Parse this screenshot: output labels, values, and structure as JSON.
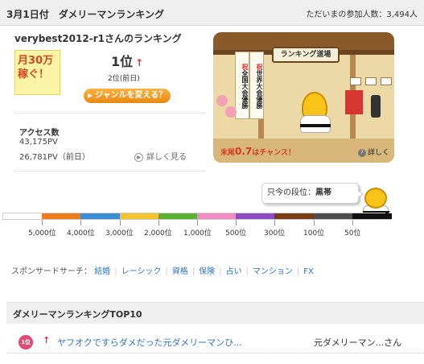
{
  "header": {
    "title": "3月1日付　ダメリーマンランキング",
    "participants": "ただいまの参加人数：3,494人"
  },
  "user": {
    "rank_title": "verybest2012-r1さんのランキング",
    "badge_line1": "月30万",
    "badge_line2": "稼ぐ！",
    "rank_now": "1位",
    "rank_change_icon": "up-arrow",
    "rank_prev": "2位(前日)",
    "genre_button": "ジャンルを変える？"
  },
  "access": {
    "title": "アクセス数",
    "now": "43,175PV",
    "prev": "26,781PV（前日）",
    "detail_link": "詳しく見る"
  },
  "banner": {
    "sign": "ランキング道場",
    "scroll1_top": "祝",
    "scroll1_text": "全国大会優勝",
    "scroll2_top": "祝",
    "scroll2_text": "世界大会優勝",
    "chance_prefix": "末尾",
    "chance_value": "0.7",
    "chance_suffix": "はチャンス！",
    "detail": "詳しく"
  },
  "level": {
    "bubble_prefix": "只今の段位：",
    "bubble_value": "黒帯",
    "current_fraction": 0.99
  },
  "gauge": {
    "colors": [
      "#ffffff",
      "#f07c1a",
      "#3c8ed4",
      "#f4c42a",
      "#5bb132",
      "#f28cc4",
      "#8d4bc4",
      "#7a3d12",
      "#4e4e4e",
      "#111111"
    ],
    "labels": [
      "5,000位",
      "4,000位",
      "3,000位",
      "2,000位",
      "1,000位",
      "500位",
      "300位",
      "100位",
      "50位"
    ]
  },
  "sponsor": {
    "label": "スポンサードサーチ：",
    "keywords": [
      "結婚",
      "レーシック",
      "資格",
      "保険",
      "占い",
      "マンション",
      "FX"
    ]
  },
  "top10": {
    "title": "ダメリーマンランキングTOP10",
    "rows": [
      {
        "rank": "1位",
        "trend": "↑",
        "title": "ヤフオクですらダメだった元ダメリーマンひ...",
        "author": "元ダメリーマン...さん"
      }
    ]
  }
}
